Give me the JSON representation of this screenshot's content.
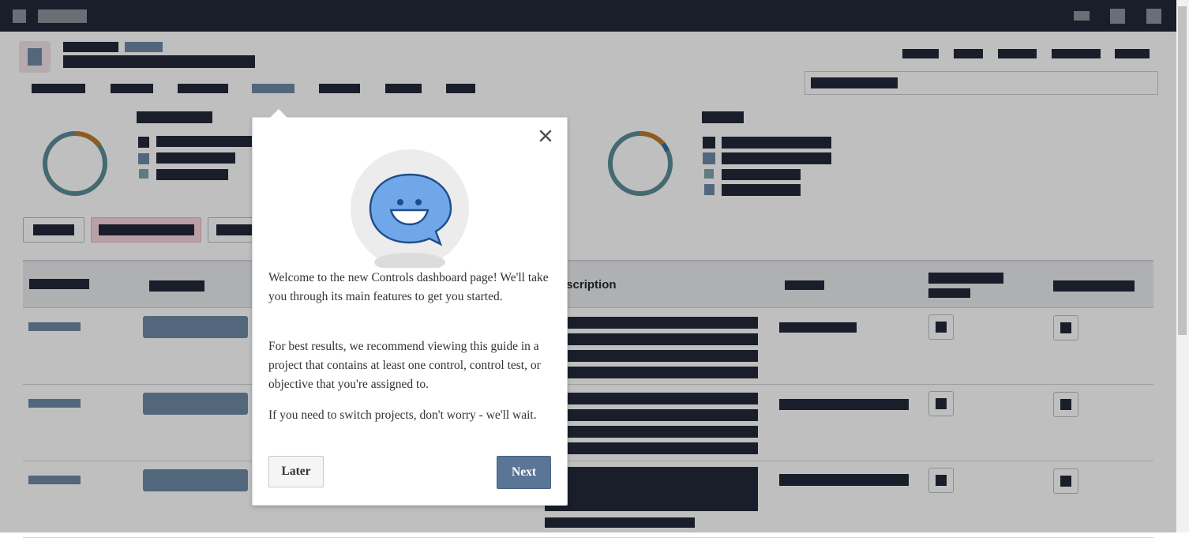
{
  "colors": {
    "topbar": "#232838",
    "accent_blue": "#2f6fe0",
    "donut_teal": "#5c8c96",
    "donut_orange": "#c07a2c",
    "donut_blue": "#2f6fa8",
    "next_button": "#5a7596"
  },
  "table": {
    "visible_header": "Description"
  },
  "popover": {
    "illustration_icon": "smiling-speech-bubble",
    "close_icon": "×",
    "paragraph_1": "Welcome to the new Controls dashboard page! We'll take you through its main features to get you started.",
    "paragraph_2": "For best results, we recommend viewing this guide in a project that contains at least one control, control test, or objective that you're assigned to.",
    "paragraph_3": "If you need to switch projects, don't worry - we'll wait.",
    "later_label": "Later",
    "next_label": "Next"
  }
}
